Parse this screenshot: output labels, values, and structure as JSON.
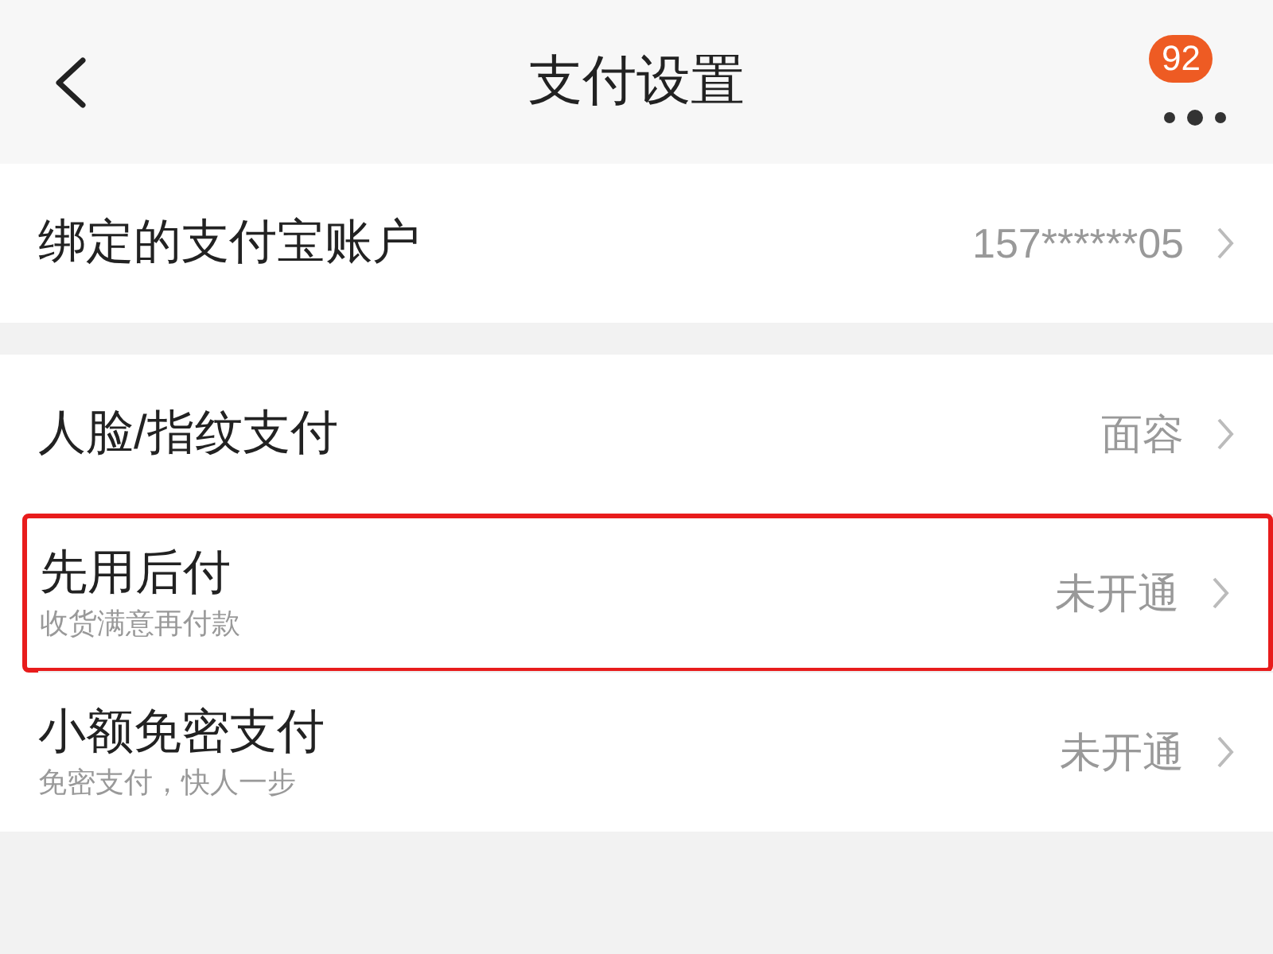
{
  "header": {
    "title": "支付设置",
    "badge": "92"
  },
  "sections": [
    {
      "rows": [
        {
          "label": "绑定的支付宝账户",
          "value": "157******05",
          "highlighted": false
        }
      ]
    },
    {
      "rows": [
        {
          "label": "人脸/指纹支付",
          "value": "面容",
          "highlighted": false
        },
        {
          "label": "先用后付",
          "subtitle": "收货满意再付款",
          "value": "未开通",
          "highlighted": true
        },
        {
          "label": "小额免密支付",
          "subtitle": "免密支付，快人一步",
          "value": "未开通",
          "highlighted": false
        }
      ]
    }
  ]
}
